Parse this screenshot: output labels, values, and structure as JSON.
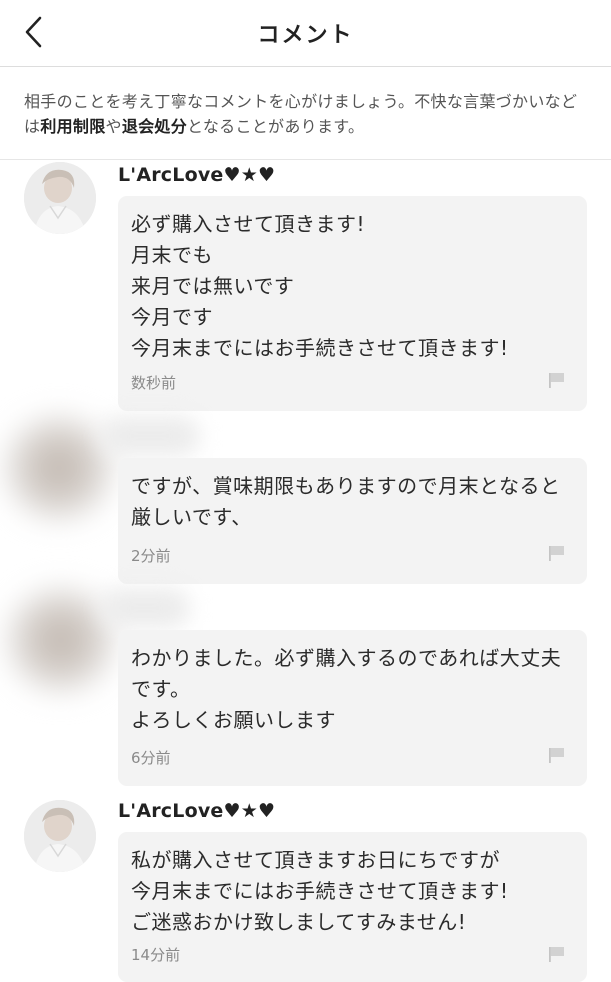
{
  "header": {
    "title": "コメント",
    "back_icon": "chevron-left-icon"
  },
  "notice": {
    "text_before": "相手のことを考え丁寧なコメントを心がけましょう。不快な言葉づかいなどは",
    "link1": "利用制限",
    "text_middle": "や",
    "link2": "退会処分",
    "text_after": "となることがあります。"
  },
  "comments": [
    {
      "username": "L'ArcLove♥★♥",
      "text": "必ず購入させて頂きます!\n月末でも\n来月では無いです\n今月です\n今月末までにはお手続きさせて頂きます!",
      "time": "数秒前"
    },
    {
      "username": "",
      "text": "ですが、賞味期限もありますので月末となると厳しいです、",
      "time": "2分前"
    },
    {
      "username": "",
      "text": "わかりました。必ず購入するのであれば大丈夫です。\nよろしくお願いします",
      "time": "6分前"
    },
    {
      "username": "L'ArcLove♥★♥",
      "text": "私が購入させて頂きますお日にちですが\n今月末までにはお手続きさせて頂きます!\nご迷惑おかけ致しましてすみません!",
      "time": "14分前"
    }
  ],
  "colors": {
    "bubble_bg": "#f3f3f3",
    "timestamp": "#8a8a8a",
    "divider": "#dddddd"
  }
}
